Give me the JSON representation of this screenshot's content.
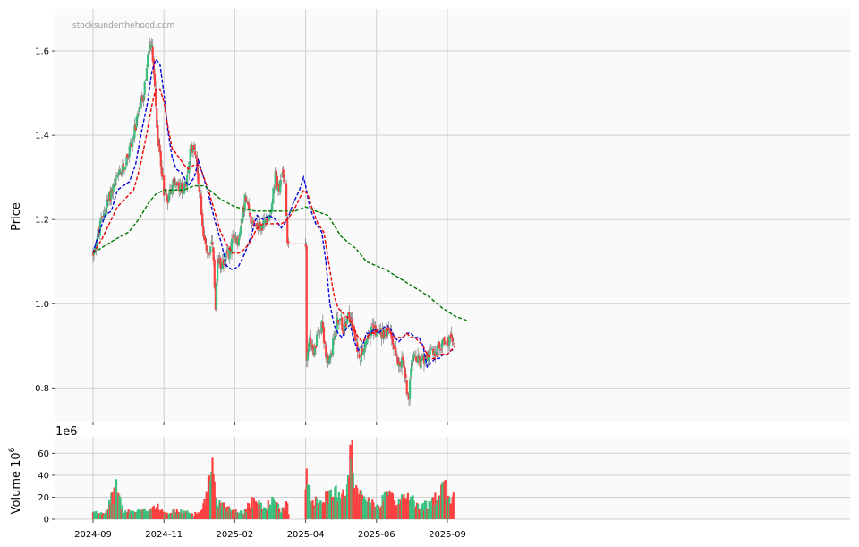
{
  "chart_data": {
    "type": "candlestick",
    "watermark": "stocksunderthehood.com",
    "price_panel": {
      "ylabel": "Price",
      "ylim": [
        0.72,
        1.7
      ],
      "yticks": [
        0.8,
        1.0,
        1.2,
        1.4,
        1.6
      ],
      "grid": true,
      "series": [
        {
          "name": "",
          "style": "dashed",
          "color": "#0000dd",
          "points": [
            [
              0,
              1.12
            ],
            [
              6,
              1.17
            ],
            [
              12,
              1.21
            ],
            [
              18,
              1.22
            ],
            [
              24,
              1.27
            ],
            [
              30,
              1.28
            ],
            [
              36,
              1.29
            ],
            [
              42,
              1.33
            ],
            [
              48,
              1.41
            ],
            [
              54,
              1.48
            ],
            [
              58,
              1.55
            ],
            [
              62,
              1.58
            ],
            [
              66,
              1.57
            ],
            [
              70,
              1.5
            ],
            [
              74,
              1.41
            ],
            [
              78,
              1.35
            ],
            [
              82,
              1.32
            ],
            [
              88,
              1.31
            ],
            [
              94,
              1.28
            ],
            [
              100,
              1.3
            ],
            [
              104,
              1.34
            ],
            [
              108,
              1.31
            ],
            [
              114,
              1.26
            ],
            [
              120,
              1.2
            ],
            [
              126,
              1.15
            ],
            [
              132,
              1.09
            ],
            [
              138,
              1.08
            ],
            [
              144,
              1.09
            ],
            [
              150,
              1.12
            ],
            [
              156,
              1.16
            ],
            [
              162,
              1.21
            ],
            [
              168,
              1.2
            ],
            [
              174,
              1.21
            ],
            [
              180,
              1.2
            ],
            [
              186,
              1.18
            ],
            [
              192,
              1.2
            ],
            [
              198,
              1.24
            ],
            [
              204,
              1.27
            ],
            [
              208,
              1.3
            ],
            [
              210,
              1.28
            ],
            [
              214,
              1.23
            ],
            [
              220,
              1.19
            ],
            [
              226,
              1.17
            ],
            [
              230,
              1.1
            ],
            [
              234,
              1.0
            ],
            [
              238,
              0.95
            ],
            [
              242,
              0.93
            ],
            [
              246,
              0.92
            ],
            [
              250,
              0.94
            ],
            [
              254,
              0.95
            ],
            [
              258,
              0.91
            ],
            [
              262,
              0.89
            ],
            [
              266,
              0.9
            ],
            [
              270,
              0.93
            ],
            [
              274,
              0.93
            ],
            [
              278,
              0.94
            ],
            [
              282,
              0.93
            ],
            [
              286,
              0.94
            ],
            [
              290,
              0.95
            ],
            [
              294,
              0.94
            ],
            [
              298,
              0.92
            ],
            [
              302,
              0.91
            ],
            [
              306,
              0.92
            ],
            [
              310,
              0.93
            ],
            [
              314,
              0.93
            ],
            [
              318,
              0.92
            ],
            [
              322,
              0.92
            ],
            [
              326,
              0.9
            ],
            [
              330,
              0.85
            ],
            [
              334,
              0.86
            ],
            [
              338,
              0.87
            ],
            [
              342,
              0.87
            ],
            [
              346,
              0.88
            ],
            [
              350,
              0.88
            ],
            [
              354,
              0.89
            ],
            [
              358,
              0.89
            ]
          ]
        },
        {
          "name": "",
          "style": "dashed",
          "color": "#ee0000",
          "points": [
            [
              0,
              1.12
            ],
            [
              8,
              1.15
            ],
            [
              16,
              1.19
            ],
            [
              24,
              1.23
            ],
            [
              32,
              1.25
            ],
            [
              40,
              1.27
            ],
            [
              46,
              1.32
            ],
            [
              52,
              1.39
            ],
            [
              58,
              1.47
            ],
            [
              62,
              1.51
            ],
            [
              66,
              1.51
            ],
            [
              70,
              1.48
            ],
            [
              74,
              1.42
            ],
            [
              78,
              1.37
            ],
            [
              84,
              1.35
            ],
            [
              90,
              1.33
            ],
            [
              94,
              1.32
            ],
            [
              100,
              1.33
            ],
            [
              104,
              1.33
            ],
            [
              108,
              1.31
            ],
            [
              114,
              1.27
            ],
            [
              120,
              1.22
            ],
            [
              126,
              1.17
            ],
            [
              132,
              1.14
            ],
            [
              138,
              1.12
            ],
            [
              144,
              1.12
            ],
            [
              150,
              1.13
            ],
            [
              156,
              1.15
            ],
            [
              162,
              1.18
            ],
            [
              168,
              1.19
            ],
            [
              174,
              1.19
            ],
            [
              180,
              1.19
            ],
            [
              186,
              1.19
            ],
            [
              192,
              1.2
            ],
            [
              198,
              1.22
            ],
            [
              204,
              1.25
            ],
            [
              208,
              1.27
            ],
            [
              212,
              1.26
            ],
            [
              216,
              1.23
            ],
            [
              222,
              1.19
            ],
            [
              228,
              1.17
            ],
            [
              234,
              1.08
            ],
            [
              238,
              1.02
            ],
            [
              242,
              0.99
            ],
            [
              246,
              0.98
            ],
            [
              250,
              0.97
            ],
            [
              254,
              0.96
            ],
            [
              258,
              0.94
            ],
            [
              262,
              0.92
            ],
            [
              266,
              0.91
            ],
            [
              270,
              0.92
            ],
            [
              274,
              0.93
            ],
            [
              278,
              0.93
            ],
            [
              282,
              0.94
            ],
            [
              286,
              0.94
            ],
            [
              290,
              0.94
            ],
            [
              294,
              0.93
            ],
            [
              298,
              0.92
            ],
            [
              302,
              0.92
            ],
            [
              306,
              0.92
            ],
            [
              310,
              0.93
            ],
            [
              314,
              0.92
            ],
            [
              318,
              0.92
            ],
            [
              322,
              0.91
            ],
            [
              326,
              0.9
            ],
            [
              330,
              0.88
            ],
            [
              334,
              0.87
            ],
            [
              338,
              0.87
            ],
            [
              342,
              0.88
            ],
            [
              346,
              0.88
            ],
            [
              350,
              0.88
            ],
            [
              354,
              0.89
            ],
            [
              358,
              0.9
            ]
          ]
        },
        {
          "name": "",
          "style": "dashed",
          "color": "#007700",
          "points": [
            [
              0,
              1.12
            ],
            [
              20,
              1.15
            ],
            [
              35,
              1.17
            ],
            [
              45,
              1.2
            ],
            [
              55,
              1.24
            ],
            [
              62,
              1.26
            ],
            [
              70,
              1.27
            ],
            [
              90,
              1.27
            ],
            [
              100,
              1.28
            ],
            [
              110,
              1.28
            ],
            [
              125,
              1.25
            ],
            [
              140,
              1.23
            ],
            [
              160,
              1.22
            ],
            [
              180,
              1.22
            ],
            [
              200,
              1.22
            ],
            [
              210,
              1.23
            ],
            [
              220,
              1.22
            ],
            [
              232,
              1.21
            ],
            [
              245,
              1.16
            ],
            [
              260,
              1.13
            ],
            [
              270,
              1.1
            ],
            [
              290,
              1.08
            ],
            [
              310,
              1.05
            ],
            [
              330,
              1.02
            ],
            [
              345,
              0.99
            ],
            [
              358,
              0.97
            ],
            [
              370,
              0.96
            ]
          ]
        }
      ]
    },
    "volume_panel": {
      "ylabel": "Volume  10",
      "ylabel_exp": "6",
      "offset_text": "1e6",
      "ylim": [
        0,
        75
      ],
      "yticks": [
        0,
        20,
        40,
        60
      ],
      "grid": true
    },
    "x_axis": {
      "tick_labels": [
        "2024-09",
        "2024-11",
        "2025-02",
        "2025-04",
        "2025-06",
        "2025-09"
      ],
      "tick_index": [
        0,
        70,
        140,
        210,
        280,
        350
      ],
      "n_periods": 356,
      "gap": [
        193,
        210
      ]
    },
    "up_color": "#3dbf7f",
    "down_color": "#ff4040",
    "generation": {
      "kind": "synthetic-ohlcv-from-anchors",
      "seed": 12345,
      "anchors": [
        [
          0,
          1.12
        ],
        [
          10,
          1.21
        ],
        [
          20,
          1.28
        ],
        [
          30,
          1.32
        ],
        [
          40,
          1.4
        ],
        [
          50,
          1.5
        ],
        [
          56,
          1.62
        ],
        [
          58,
          1.6
        ],
        [
          62,
          1.48
        ],
        [
          64,
          1.38
        ],
        [
          66,
          1.36
        ],
        [
          70,
          1.27
        ],
        [
          74,
          1.25
        ],
        [
          80,
          1.29
        ],
        [
          86,
          1.27
        ],
        [
          92,
          1.28
        ],
        [
          96,
          1.36
        ],
        [
          100,
          1.38
        ],
        [
          106,
          1.25
        ],
        [
          110,
          1.14
        ],
        [
          114,
          1.12
        ],
        [
          118,
          1.14
        ],
        [
          121,
          0.98
        ],
        [
          123,
          1.09
        ],
        [
          128,
          1.1
        ],
        [
          134,
          1.12
        ],
        [
          140,
          1.16
        ],
        [
          144,
          1.15
        ],
        [
          150,
          1.25
        ],
        [
          156,
          1.2
        ],
        [
          160,
          1.19
        ],
        [
          166,
          1.18
        ],
        [
          172,
          1.2
        ],
        [
          176,
          1.23
        ],
        [
          180,
          1.3
        ],
        [
          184,
          1.27
        ],
        [
          188,
          1.31
        ],
        [
          190,
          1.27
        ],
        [
          192,
          1.14
        ],
        [
          193,
          1.14
        ],
        [
          210,
          1.14
        ],
        [
          211,
          0.88
        ],
        [
          214,
          0.92
        ],
        [
          218,
          0.87
        ],
        [
          222,
          0.93
        ],
        [
          226,
          0.96
        ],
        [
          230,
          0.88
        ],
        [
          232,
          0.85
        ],
        [
          236,
          0.89
        ],
        [
          240,
          0.95
        ],
        [
          244,
          0.97
        ],
        [
          248,
          0.93
        ],
        [
          252,
          0.99
        ],
        [
          256,
          0.95
        ],
        [
          260,
          0.9
        ],
        [
          264,
          0.88
        ],
        [
          270,
          0.92
        ],
        [
          276,
          0.94
        ],
        [
          282,
          0.93
        ],
        [
          288,
          0.93
        ],
        [
          294,
          0.93
        ],
        [
          300,
          0.87
        ],
        [
          306,
          0.86
        ],
        [
          310,
          0.8
        ],
        [
          312,
          0.78
        ],
        [
          314,
          0.86
        ],
        [
          318,
          0.87
        ],
        [
          324,
          0.86
        ],
        [
          330,
          0.88
        ],
        [
          336,
          0.88
        ],
        [
          342,
          0.9
        ],
        [
          348,
          0.91
        ],
        [
          354,
          0.91
        ],
        [
          358,
          0.92
        ]
      ],
      "volume_anchors": [
        [
          0,
          6
        ],
        [
          12,
          7
        ],
        [
          24,
          30
        ],
        [
          30,
          7
        ],
        [
          50,
          8
        ],
        [
          60,
          13
        ],
        [
          70,
          8
        ],
        [
          90,
          7
        ],
        [
          100,
          5
        ],
        [
          108,
          8
        ],
        [
          112,
          23
        ],
        [
          118,
          45
        ],
        [
          120,
          27
        ],
        [
          124,
          16
        ],
        [
          140,
          8
        ],
        [
          150,
          8
        ],
        [
          156,
          19
        ],
        [
          170,
          10
        ],
        [
          176,
          18
        ],
        [
          186,
          8
        ],
        [
          192,
          17
        ],
        [
          193,
          8
        ],
        [
          210,
          48
        ],
        [
          212,
          30
        ],
        [
          216,
          20
        ],
        [
          230,
          20
        ],
        [
          240,
          25
        ],
        [
          250,
          28
        ],
        [
          256,
          70
        ],
        [
          258,
          28
        ],
        [
          270,
          18
        ],
        [
          280,
          12
        ],
        [
          292,
          26
        ],
        [
          300,
          14
        ],
        [
          310,
          25
        ],
        [
          320,
          12
        ],
        [
          335,
          15
        ],
        [
          346,
          40
        ],
        [
          350,
          18
        ],
        [
          356,
          19
        ]
      ]
    }
  }
}
